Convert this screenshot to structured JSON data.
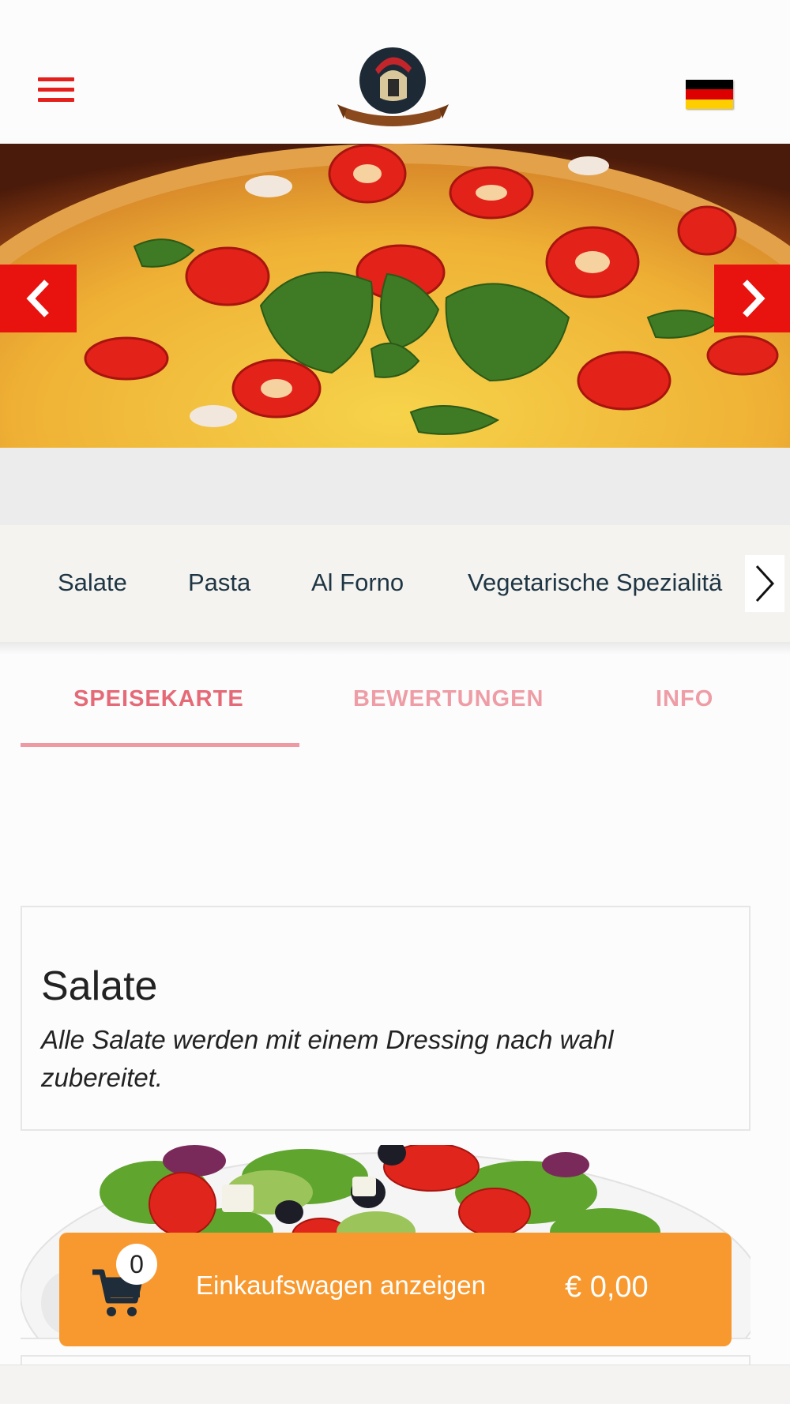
{
  "header": {
    "menu_icon": "hamburger-menu-icon",
    "logo": "restaurant-logo-warrior-helmet",
    "language_flag": "german-flag",
    "flag_colors": [
      "#000000",
      "#dd0000",
      "#ffce00"
    ]
  },
  "hero": {
    "image": "pizza-with-tomatoes-and-basil",
    "prev_icon": "chevron-left-icon",
    "next_icon": "chevron-right-icon"
  },
  "categories": {
    "items": [
      "Salate",
      "Pasta",
      "Al Forno",
      "Vegetarische Spezialitä"
    ],
    "next_icon": "chevron-right-icon"
  },
  "tabs": [
    {
      "label": "SPEISEKARTE",
      "active": true
    },
    {
      "label": "BEWERTUNGEN",
      "active": false
    },
    {
      "label": "INFO",
      "active": false
    }
  ],
  "section": {
    "title": "Salate",
    "description": "Alle Salate werden mit einem Dressing nach wahl zubereitet.",
    "image": "mixed-salad-plate"
  },
  "cart": {
    "icon": "shopping-cart-icon",
    "count": "0",
    "label": "Einkaufswagen anzeigen",
    "total": "€ 0,00"
  },
  "colors": {
    "accent_red": "#e8120e",
    "tab_active": "#e56a78",
    "cart_orange": "#f8992f"
  }
}
